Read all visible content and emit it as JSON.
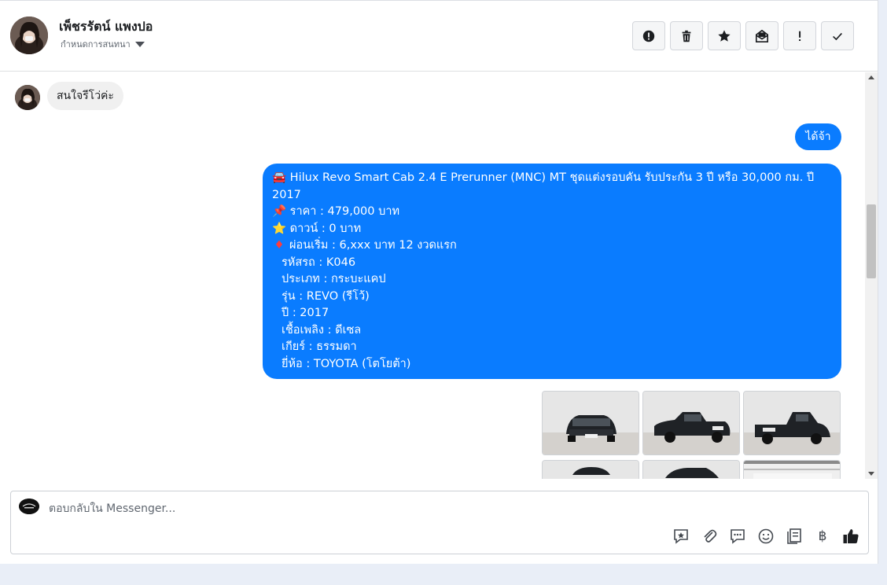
{
  "header": {
    "contact_name": "เพ็ชรรัตน์ แพงปอ",
    "assign_label": "กำหนดการสนทนา",
    "actions": [
      {
        "icon": "alert-circle-icon"
      },
      {
        "icon": "trash-icon"
      },
      {
        "icon": "star-icon"
      },
      {
        "icon": "mail-unread-icon"
      },
      {
        "icon": "exclamation-icon"
      },
      {
        "icon": "checkmark-icon"
      }
    ]
  },
  "thread": {
    "incoming": {
      "text": "สนใจรีโว่ค่ะ"
    },
    "outgoing_short": {
      "text": "ได้จ้า"
    },
    "listing": {
      "title_emoji": "🚘",
      "title_line1": "Hilux Revo Smart Cab 2.4 E Prerunner (MNC) MT ชุดแต่งรอบคัน รับประกัน 3 ปี หรือ 30,000 กม. ปี",
      "title_line2": "2017",
      "price_emoji": "📌",
      "price": "ราคา : 479,000 บาท",
      "down_emoji": "⭐",
      "down": "ดาวน์ : 0 บาท",
      "installment_emoji": "♦",
      "installment": "ผ่อนเริ่ม : 6,xxx บาท 12 งวดแรก",
      "code": "รหัสรถ : K046",
      "type": "ประเภท : กระบะแคป",
      "model": "รุ่น : REVO (รีโว้)",
      "year": "ปี : 2017",
      "fuel": "เชื้อเพลิง : ดีเซล",
      "gear": "เกียร์ : ธรรมดา",
      "brand": "ยี่ห้อ : TOYOTA (โตโยต้า)"
    },
    "photo_count": 6
  },
  "composer": {
    "placeholder": "ตอบกลับใน Messenger...",
    "tools": [
      "saved-reply-icon",
      "attachment-icon",
      "chat-bubble-icon",
      "emoji-icon",
      "notes-icon",
      "baht-icon",
      "thumbs-up-icon"
    ],
    "baht_symbol": "฿"
  },
  "colors": {
    "accent": "#0a7cff",
    "incoming_bubble": "#f0f0f0",
    "background": "#e9eef7"
  }
}
